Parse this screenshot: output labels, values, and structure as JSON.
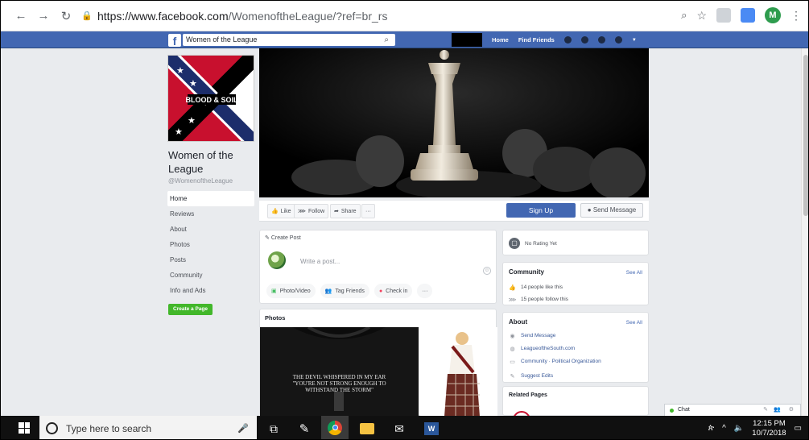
{
  "browser": {
    "url_host": "https://www.facebook.com",
    "url_path": "/WomenoftheLeague/?ref=br_rs",
    "profile_initial": "M"
  },
  "fb_header": {
    "search_value": "Women of the League",
    "nav_home": "Home",
    "nav_find_friends": "Find Friends"
  },
  "profile": {
    "image_text": "BLOOD & SOIL",
    "name": "Women of the League",
    "handle": "@WomenoftheLeague"
  },
  "left_nav": [
    "Home",
    "Reviews",
    "About",
    "Photos",
    "Posts",
    "Community",
    "Info and Ads"
  ],
  "create_page_label": "Create a Page",
  "actions": {
    "like": "Like",
    "follow": "Follow",
    "share": "Share",
    "more": "···",
    "sign_up": "Sign Up",
    "send_message": "Send Message"
  },
  "create_post": {
    "title": "Create Post",
    "placeholder": "Write a post...",
    "photo_video": "Photo/Video",
    "tag_friends": "Tag Friends",
    "check_in": "Check in",
    "more": "···"
  },
  "photos": {
    "title": "Photos",
    "shirt_line1": "THE DEVIL WHISPERED IN MY EAR",
    "shirt_line2": "\"YOU'RE NOT STRONG ENOUGH TO",
    "shirt_line3": "WITHSTAND THE STORM\""
  },
  "rating": {
    "text": "No Rating Yet"
  },
  "community": {
    "title": "Community",
    "see_all": "See All",
    "likes": "14 people like this",
    "follows": "15 people follow this"
  },
  "about": {
    "title": "About",
    "see_all": "See All",
    "send_message": "Send Message",
    "website": "LeagueoftheSouth.com",
    "category": "Community · Political Organization",
    "suggest_edits": "Suggest Edits"
  },
  "related": {
    "title": "Related Pages"
  },
  "chat": {
    "label": "Chat"
  },
  "taskbar": {
    "search_placeholder": "Type here to search",
    "time": "12:15 PM",
    "date": "10/7/2018"
  },
  "colors": {
    "fb_blue": "#4267b2",
    "page_bg": "#e9ebee",
    "green": "#42b72a"
  }
}
